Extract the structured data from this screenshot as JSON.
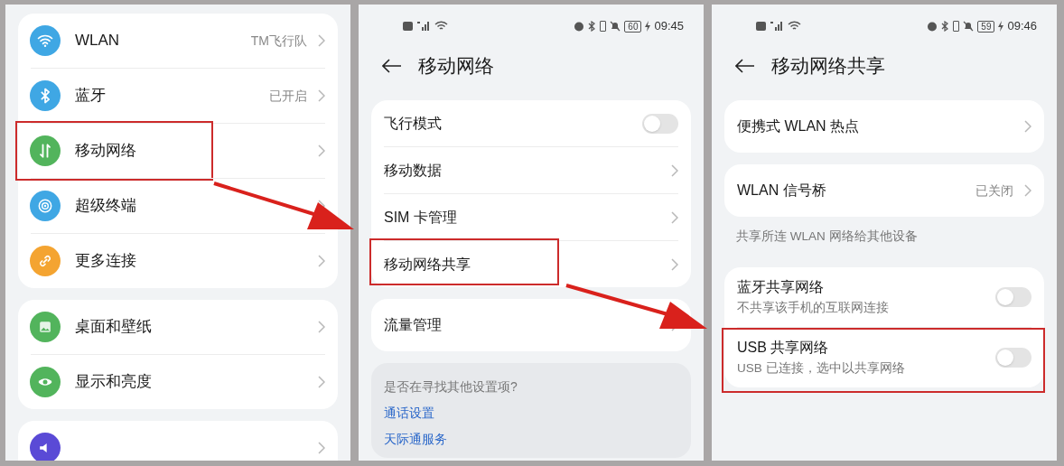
{
  "panels": [
    {
      "groups": [
        {
          "rows": [
            {
              "kind": "nav",
              "label": "WLAN",
              "value": "TM飞行队",
              "color": "#3fa7e4",
              "highlighted": false
            },
            {
              "kind": "nav",
              "label": "蓝牙",
              "value": "已开启",
              "color": "#3fa7e4",
              "highlighted": false
            },
            {
              "kind": "nav",
              "label": "移动网络",
              "color": "#52b45c",
              "highlighted": true
            },
            {
              "kind": "nav",
              "label": "超级终端",
              "color": "#3fa7e4",
              "highlighted": false
            },
            {
              "kind": "nav",
              "label": "更多连接",
              "color": "#f4a431",
              "highlighted": false
            }
          ]
        },
        {
          "rows": [
            {
              "kind": "nav",
              "label": "桌面和壁纸",
              "color": "#52b45c",
              "highlighted": false
            },
            {
              "kind": "nav",
              "label": "显示和亮度",
              "color": "#52b45c",
              "highlighted": false
            }
          ]
        },
        {
          "rows": [
            {
              "kind": "nav",
              "color": "#5a4ad6",
              "highlighted": false
            }
          ]
        }
      ]
    },
    {
      "status_bar": {
        "battery": "60",
        "time": "09:45"
      },
      "title": "移动网络",
      "groups": [
        {
          "rows": [
            {
              "kind": "toggle",
              "label": "飞行模式",
              "on": false,
              "highlighted": false
            },
            {
              "kind": "nav",
              "label": "移动数据",
              "highlighted": false
            },
            {
              "kind": "nav",
              "label": "SIM 卡管理",
              "highlighted": false
            },
            {
              "kind": "nav",
              "label": "移动网络共享",
              "highlighted": true
            }
          ]
        },
        {
          "rows": [
            {
              "kind": "nav",
              "label": "流量管理",
              "highlighted": false
            }
          ]
        }
      ],
      "suggestions": {
        "prompt": "是否在寻找其他设置项?",
        "links": [
          "通话设置",
          "天际通服务"
        ]
      }
    },
    {
      "status_bar": {
        "battery": "59",
        "time": "09:46"
      },
      "title": "移动网络共享",
      "groups": [
        {
          "rows": [
            {
              "kind": "nav",
              "label": "便携式 WLAN 热点",
              "highlighted": false
            }
          ]
        },
        {
          "rows": [
            {
              "kind": "nav",
              "label": "WLAN 信号桥",
              "value": "已关闭",
              "highlighted": false
            }
          ],
          "footer": "共享所连 WLAN 网络给其他设备"
        },
        {
          "rows": [
            {
              "kind": "toggle",
              "label": "蓝牙共享网络",
              "subtitle": "不共享该手机的互联网连接",
              "on": false,
              "highlighted": false
            },
            {
              "kind": "toggle",
              "label": "USB 共享网络",
              "subtitle": "USB 已连接，选中以共享网络",
              "on": false,
              "highlighted": true
            }
          ]
        }
      ]
    }
  ]
}
